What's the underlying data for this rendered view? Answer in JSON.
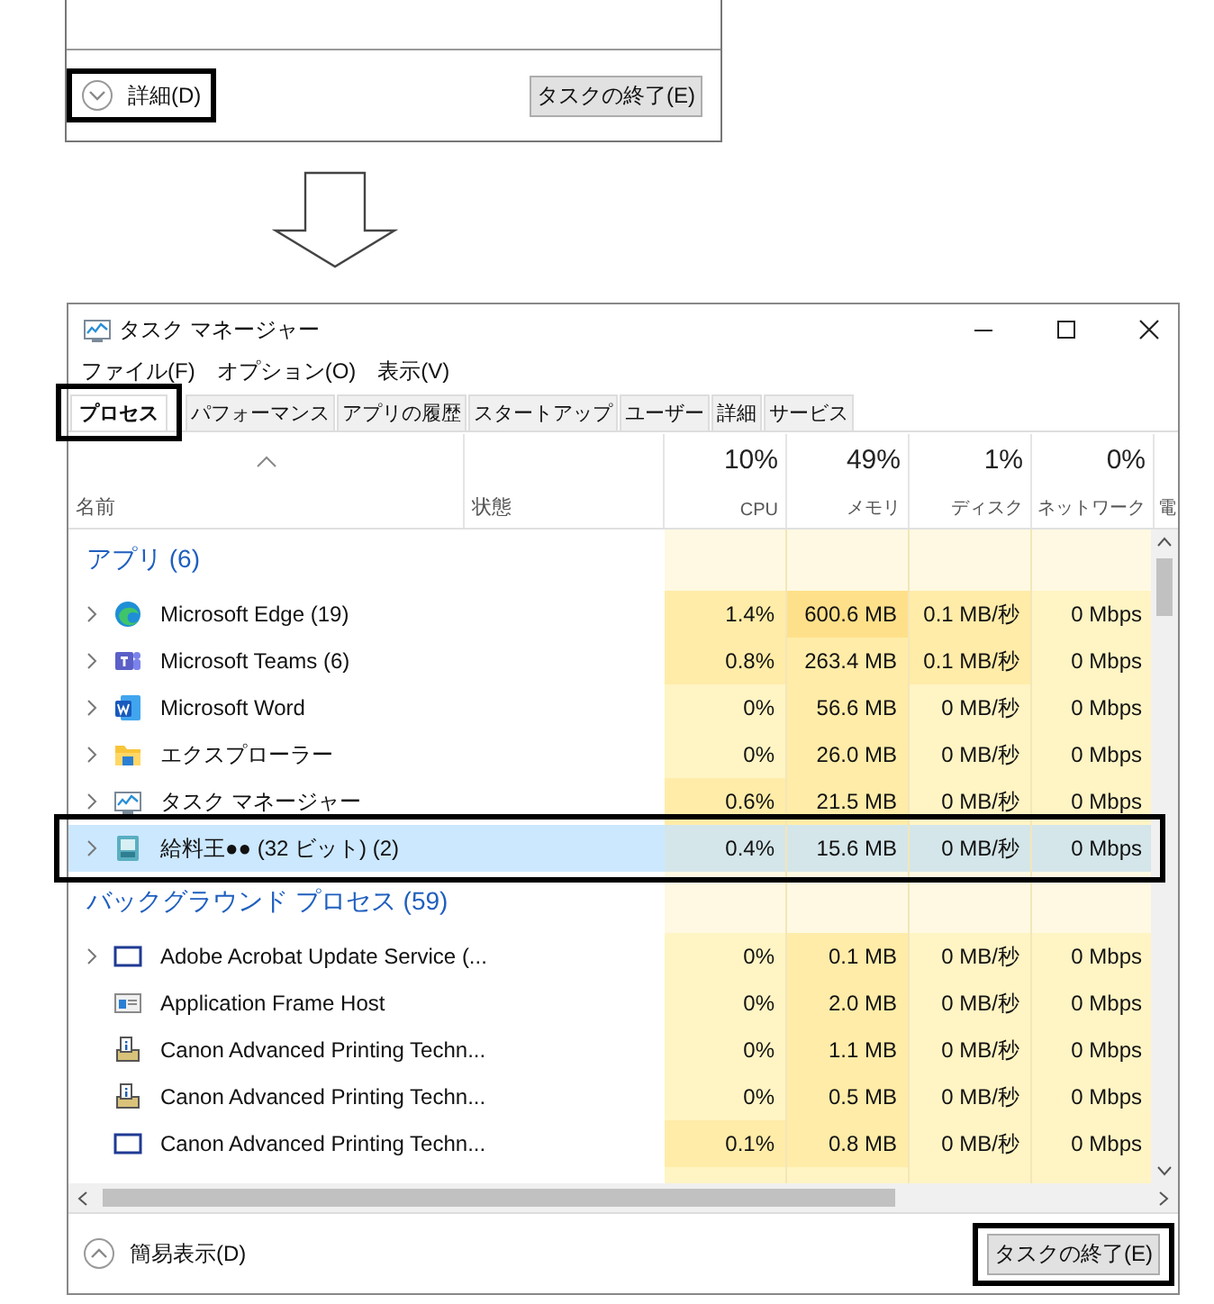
{
  "compact_view": {
    "more_details": "詳細(D)",
    "end_task": "タスクの終了(E)"
  },
  "window": {
    "title": "タスク マネージャー"
  },
  "menu": [
    "ファイル(F)",
    "オプション(O)",
    "表示(V)"
  ],
  "tabs": [
    {
      "label": "プロセス",
      "selected": true
    },
    {
      "label": "パフォーマンス",
      "selected": false
    },
    {
      "label": "アプリの履歴",
      "selected": false
    },
    {
      "label": "スタートアップ",
      "selected": false
    },
    {
      "label": "ユーザー",
      "selected": false
    },
    {
      "label": "詳細",
      "selected": false
    },
    {
      "label": "サービス",
      "selected": false
    }
  ],
  "columns": [
    {
      "name": "名前",
      "sorted": true
    },
    {
      "name": "状態",
      "sorted": false
    },
    {
      "percent": "10%",
      "name": "CPU",
      "sorted": false
    },
    {
      "percent": "49%",
      "name": "メモリ",
      "sorted": false
    },
    {
      "percent": "1%",
      "name": "ディスク",
      "sorted": false
    },
    {
      "percent": "0%",
      "name": "ネットワーク",
      "sorted": false
    },
    {
      "name": "電",
      "sorted": false
    }
  ],
  "groups": [
    {
      "title": "アプリ (6)",
      "rows": [
        {
          "name": "Microsoft Edge (19)",
          "kind": "edge",
          "expandable": true,
          "selected": false,
          "cells": [
            {
              "text": "1.4%",
              "color": "#ffeca8"
            },
            {
              "text": "600.6 MB",
              "color": "#ffe08a"
            },
            {
              "text": "0.1 MB/秒",
              "color": "#ffeca8"
            },
            {
              "text": "0 Mbps",
              "color": "#fff4c4"
            }
          ]
        },
        {
          "name": "Microsoft Teams (6)",
          "kind": "teams",
          "expandable": true,
          "selected": false,
          "cells": [
            {
              "text": "0.8%",
              "color": "#ffeca8"
            },
            {
              "text": "263.4 MB",
              "color": "#ffeca8"
            },
            {
              "text": "0.1 MB/秒",
              "color": "#ffeca8"
            },
            {
              "text": "0 Mbps",
              "color": "#fff4c4"
            }
          ]
        },
        {
          "name": "Microsoft Word",
          "kind": "word",
          "expandable": true,
          "selected": false,
          "cells": [
            {
              "text": "0%",
              "color": "#fff4c4"
            },
            {
              "text": "56.6 MB",
              "color": "#ffeca8"
            },
            {
              "text": "0 MB/秒",
              "color": "#fff4c4"
            },
            {
              "text": "0 Mbps",
              "color": "#fff4c4"
            }
          ]
        },
        {
          "name": "エクスプローラー",
          "kind": "folder",
          "expandable": true,
          "selected": false,
          "cells": [
            {
              "text": "0%",
              "color": "#fff4c4"
            },
            {
              "text": "26.0 MB",
              "color": "#ffeca8"
            },
            {
              "text": "0 MB/秒",
              "color": "#fff4c4"
            },
            {
              "text": "0 Mbps",
              "color": "#fff4c4"
            }
          ]
        },
        {
          "name": "タスク マネージャー",
          "kind": "taskmgr",
          "expandable": true,
          "selected": false,
          "cells": [
            {
              "text": "0.6%",
              "color": "#ffeca8"
            },
            {
              "text": "21.5 MB",
              "color": "#ffeca8"
            },
            {
              "text": "0 MB/秒",
              "color": "#fff4c4"
            },
            {
              "text": "0 Mbps",
              "color": "#fff4c4"
            }
          ]
        },
        {
          "name": "給料王●● (32 ビット) (2)",
          "kind": "payroll",
          "expandable": true,
          "selected": true,
          "cells": [
            {
              "text": "0.4%"
            },
            {
              "text": "15.6 MB"
            },
            {
              "text": "0 MB/秒"
            },
            {
              "text": "0 Mbps"
            }
          ]
        }
      ]
    },
    {
      "title": "バックグラウンド プロセス (59)",
      "rows": [
        {
          "name": "Adobe Acrobat Update Service (...",
          "kind": "window",
          "expandable": true,
          "selected": false,
          "cells": [
            {
              "text": "0%",
              "color": "#fff4c4"
            },
            {
              "text": "0.1 MB",
              "color": "#ffeca8"
            },
            {
              "text": "0 MB/秒",
              "color": "#fff4c4"
            },
            {
              "text": "0 Mbps",
              "color": "#fff4c4"
            }
          ]
        },
        {
          "name": "Application Frame Host",
          "kind": "appframe",
          "expandable": false,
          "selected": false,
          "cells": [
            {
              "text": "0%",
              "color": "#fff4c4"
            },
            {
              "text": "2.0 MB",
              "color": "#ffeca8"
            },
            {
              "text": "0 MB/秒",
              "color": "#fff4c4"
            },
            {
              "text": "0 Mbps",
              "color": "#fff4c4"
            }
          ]
        },
        {
          "name": "Canon Advanced Printing Techn...",
          "kind": "printer",
          "expandable": false,
          "selected": false,
          "cells": [
            {
              "text": "0%",
              "color": "#fff4c4"
            },
            {
              "text": "1.1 MB",
              "color": "#ffeca8"
            },
            {
              "text": "0 MB/秒",
              "color": "#fff4c4"
            },
            {
              "text": "0 Mbps",
              "color": "#fff4c4"
            }
          ]
        },
        {
          "name": "Canon Advanced Printing Techn...",
          "kind": "printer",
          "expandable": false,
          "selected": false,
          "cells": [
            {
              "text": "0%",
              "color": "#fff4c4"
            },
            {
              "text": "0.5 MB",
              "color": "#ffeca8"
            },
            {
              "text": "0 MB/秒",
              "color": "#fff4c4"
            },
            {
              "text": "0 Mbps",
              "color": "#fff4c4"
            }
          ]
        },
        {
          "name": "Canon Advanced Printing Techn...",
          "kind": "window",
          "expandable": false,
          "selected": false,
          "cells": [
            {
              "text": "0.1%",
              "color": "#ffeca8"
            },
            {
              "text": "0.8 MB",
              "color": "#ffeca8"
            },
            {
              "text": "0 MB/秒",
              "color": "#fff4c4"
            },
            {
              "text": "0 Mbps",
              "color": "#fff4c4"
            }
          ]
        }
      ]
    }
  ],
  "footer": {
    "fewer_details": "簡易表示(D)",
    "end_task": "タスクの終了(E)"
  }
}
